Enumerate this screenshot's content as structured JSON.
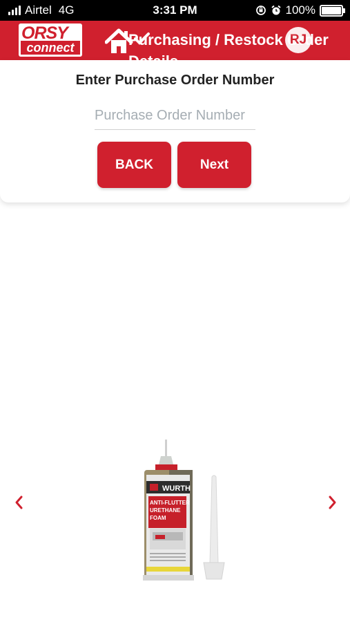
{
  "status_bar": {
    "carrier": "Airtel",
    "network": "4G",
    "time": "3:31 PM",
    "battery": "100%",
    "battery_level": 1.0
  },
  "header": {
    "logo_line1": "ORSY",
    "logo_line2": "connect",
    "title": "Purchasing / Restock Order Details",
    "avatar_initials": "RJ",
    "icons": [
      "home-icon",
      "checkmark-icon"
    ]
  },
  "card": {
    "title": "Enter Purchase Order Number",
    "po_input": {
      "value": "",
      "placeholder": "Purchase Order Number"
    },
    "back_label": "BACK",
    "next_label": "Next"
  },
  "carousel": {
    "prev_icon": "chevron-left-icon",
    "next_icon": "chevron-right-icon",
    "product": {
      "brand": "WURTH",
      "label_line1": "ANTI-FLUTTER",
      "label_line2": "URETHANE",
      "label_line3": "FOAM"
    }
  },
  "colors": {
    "brand_red": "#d0202e",
    "text_dark": "#222222",
    "placeholder": "#a5adb3"
  }
}
